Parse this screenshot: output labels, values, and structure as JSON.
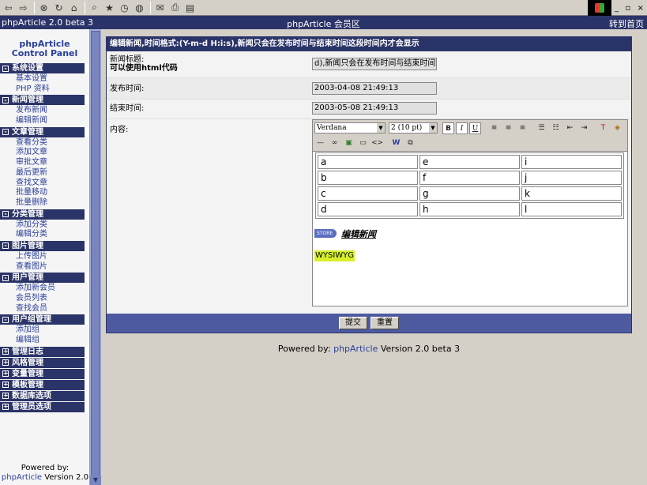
{
  "toolbar": {
    "icons": [
      "back-icon",
      "forward-icon",
      "stop-icon",
      "refresh-icon",
      "home-icon",
      "search-icon",
      "favorites-icon",
      "history-icon",
      "media-icon",
      "mail-icon",
      "print-icon",
      "edit-icon"
    ],
    "glyphs": [
      "⇦",
      "⇨",
      "⊗",
      "↻",
      "⌂",
      "⌕",
      "★",
      "◷",
      "◍",
      "✉",
      "⎙",
      "▤"
    ]
  },
  "window": {
    "controls": [
      "_",
      "▫",
      "×"
    ]
  },
  "titlebar": {
    "left": "phpArticle 2.0 beta 3",
    "center": "phpArticle 会员区",
    "right": "转到首页"
  },
  "sidebar": {
    "title_line1": "phpArticle",
    "title_line2": "Control Panel",
    "sections": [
      {
        "title": "系统设置",
        "sign": "-",
        "items": [
          "基本设置",
          "PHP 资料"
        ]
      },
      {
        "title": "新闻管理",
        "sign": "-",
        "items": [
          "发布新闻",
          "编辑新闻"
        ]
      },
      {
        "title": "文章管理",
        "sign": "-",
        "items": [
          "查看分类",
          "添加文章",
          "审批文章",
          "最后更新",
          "查找文章",
          "批量移动",
          "批量删除"
        ]
      },
      {
        "title": "分类管理",
        "sign": "-",
        "items": [
          "添加分类",
          "编辑分类"
        ]
      },
      {
        "title": "图片管理",
        "sign": "-",
        "items": [
          "上传图片",
          "查看图片"
        ]
      },
      {
        "title": "用户管理",
        "sign": "-",
        "items": [
          "添加新会员",
          "会员列表",
          "查找会员"
        ]
      },
      {
        "title": "用户组管理",
        "sign": "-",
        "items": [
          "添加组",
          "编辑组"
        ]
      },
      {
        "title": "管理日志",
        "sign": "+",
        "items": []
      },
      {
        "title": "风格管理",
        "sign": "+",
        "items": []
      },
      {
        "title": "变量管理",
        "sign": "+",
        "items": []
      },
      {
        "title": "模板管理",
        "sign": "+",
        "items": []
      },
      {
        "title": "数据库选项",
        "sign": "+",
        "items": []
      },
      {
        "title": "管理员选项",
        "sign": "+",
        "items": []
      }
    ],
    "powered_by": "Powered by:",
    "powered_link": "phpArticle",
    "powered_version": "Version 2.0"
  },
  "main": {
    "header": "编辑新闻,时间格式:(Y-m-d H:i:s),新闻只会在发布时间与结束时间这段时间内才会显示",
    "title_label": "新闻标题:",
    "title_hint": "可以使用html代码",
    "title_value": "d),新闻只会在发布时间与结束时间这",
    "publish_label": "发布时间:",
    "publish_value": "2003-04-08 21:49:13",
    "end_label": "结束时间:",
    "end_value": "2003-05-08 21:49:13",
    "content_label": "内容:",
    "submit_label": "提交",
    "reset_label": "重置"
  },
  "editor": {
    "font": "Verdana",
    "size": "2 (10 pt)",
    "bold": "B",
    "italic": "I",
    "underline": "U",
    "table": [
      [
        "a",
        "e",
        "i"
      ],
      [
        "b",
        "f",
        "j"
      ],
      [
        "c",
        "g",
        "k"
      ],
      [
        "d",
        "h",
        "l"
      ]
    ],
    "badge": "STORE",
    "edit_news": "编辑新闻",
    "wysiwyg": "WYSIWYG"
  },
  "footer": {
    "powered_by": "Powered by:",
    "link": "phpArticle",
    "version": "Version 2.0 beta 3"
  }
}
